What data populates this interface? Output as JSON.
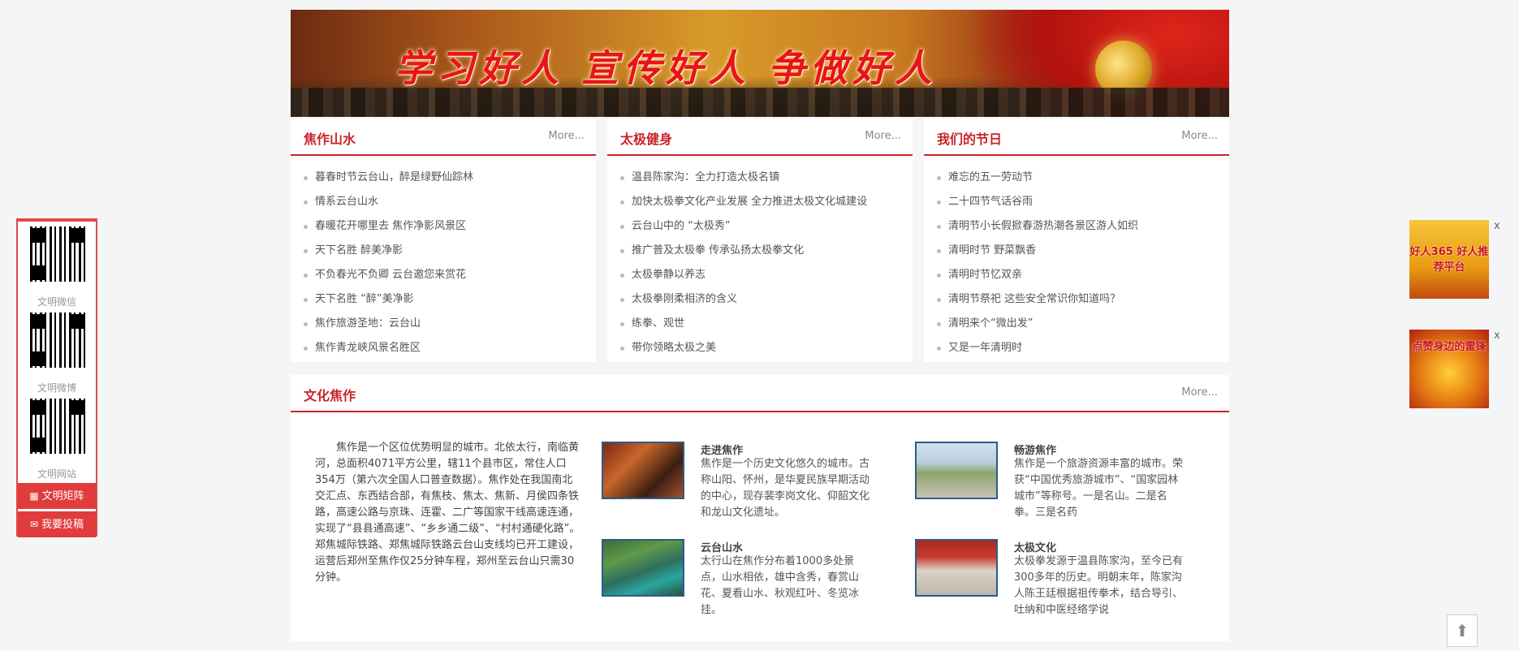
{
  "banner": {
    "slogan": "学习好人 宣传好人 争做好人"
  },
  "sections": [
    {
      "title": "焦作山水",
      "more": "More...",
      "items": [
        "暮春时节云台山，醉是绿野仙踪林",
        "情系云台山水",
        "春暖花开哪里去 焦作净影风景区",
        "天下名胜 醉美净影",
        "不负春光不负卿 云台邀您来赏花",
        "天下名胜 “醉”美净影",
        "焦作旅游圣地：云台山",
        "焦作青龙峡风景名胜区"
      ]
    },
    {
      "title": "太极健身",
      "more": "More...",
      "items": [
        "温县陈家沟：全力打造太极名镇",
        "加快太极拳文化产业发展 全力推进太极文化城建设",
        "云台山中的 “太极秀”",
        "推广普及太极拳 传承弘扬太极拳文化",
        "太极拳静以养志",
        "太极拳刚柔相济的含义",
        "练拳、观世",
        "带你领略太极之美"
      ]
    },
    {
      "title": "我们的节日",
      "more": "More...",
      "items": [
        "难忘的五一劳动节",
        "二十四节气话谷雨",
        "清明节小长假掀春游热潮各景区游人如织",
        "清明时节 野菜飘香",
        "清明时节忆双亲",
        "清明节祭祀 这些安全常识你知道吗？",
        "清明来个“微出发”",
        "又是一年清明时"
      ]
    }
  ],
  "culture": {
    "title": "文化焦作",
    "more": "More...",
    "intro": "焦作是一个区位优势明显的城市。北依太行，南临黄河，总面积4071平方公里，辖11个县市区，常住人口354万（第六次全国人口普查数据）。焦作处在我国南北交汇点、东西结合部，有焦枝、焦太、焦新、月侯四条铁路，高速公路与京珠、连霍、二广等国家干线高速连通，实现了“县县通高速”、“乡乡通二级”、“村村通硬化路”。郑焦城际铁路、郑焦城际铁路云台山支线均已开工建设，运营后郑州至焦作仅25分钟车程，郑州至云台山只需30分钟。",
    "features": [
      {
        "title": "走进焦作",
        "desc": "焦作是一个历史文化悠久的城市。古称山阳、怀州，是华夏民族早期活动的中心，现存裴李岗文化、仰韶文化和龙山文化遗址。"
      },
      {
        "title": "畅游焦作",
        "desc": "焦作是一个旅游资源丰富的城市。荣获“中国优秀旅游城市”、“国家园林城市”等称号。一是名山。二是名拳。三是名药"
      },
      {
        "title": "云台山水",
        "desc": "太行山在焦作分布着1000多处景点，山水相依，雄中含秀，春赏山花、夏看山水、秋观红叶、冬览冰挂。"
      },
      {
        "title": "太极文化",
        "desc": "太极拳发源于温县陈家沟，至今已有300多年的历史。明朝末年，陈家沟人陈王廷根据祖传拳术，结合导引、吐纳和中医经络学说"
      }
    ]
  },
  "leftbar": {
    "qr_labels": [
      "文明微信",
      "文明微博",
      "文明网站"
    ],
    "btn_matrix": "文明矩阵",
    "btn_submit": "我要投稿",
    "icon_matrix": "▦",
    "icon_submit": "✉"
  },
  "ads": [
    {
      "text": "好人365 好人推荐平台",
      "close": "x"
    },
    {
      "text": "点赞身边的雷锋",
      "close": "x"
    }
  ],
  "totop": {
    "icon": "⬆"
  }
}
